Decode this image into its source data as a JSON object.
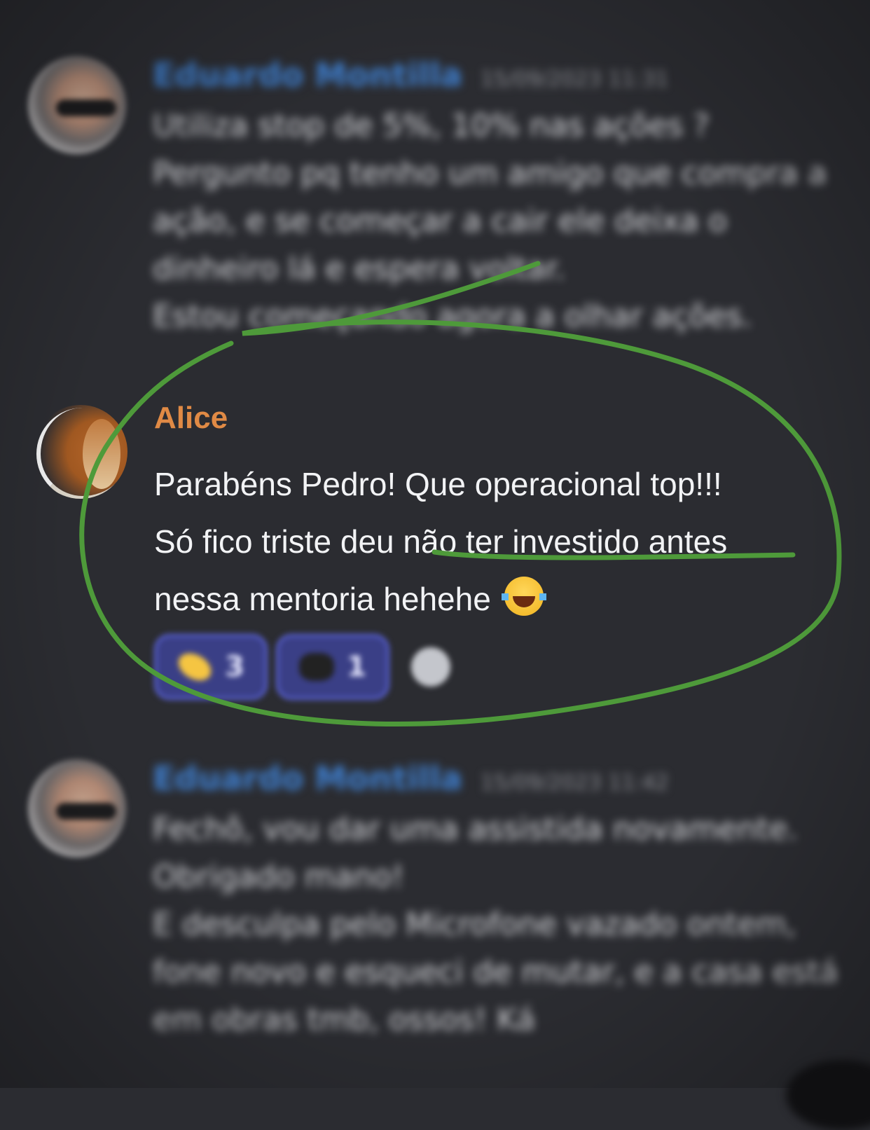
{
  "messages": [
    {
      "id": "msg-1",
      "author": "Eduardo Montilla",
      "timestamp": "15/09/2023 11:31",
      "blurred": true,
      "lines": [
        "Utiliza stop de 5%, 10% nas ações ?",
        "Pergunto pq tenho um amigo que compra a",
        "ação, e se começar a cair ele deixa o",
        "dinheiro lá e espera voltar.",
        "Estou começando agora a olhar ações."
      ]
    },
    {
      "id": "msg-2",
      "author": "Alice",
      "author_color": "#e08a45",
      "blurred": false,
      "lines": [
        "Parabéns Pedro! Que operacional top!!!",
        "Só fico triste deu não ter investido antes",
        "nessa mentoria hehehe"
      ],
      "emoji": "joy-emoji",
      "reactions": [
        {
          "emoji": "moon-reaction-icon",
          "count": "3"
        },
        {
          "emoji": "dark-reaction-icon",
          "count": "1"
        }
      ]
    },
    {
      "id": "msg-3",
      "author": "Eduardo Montilla",
      "timestamp": "15/09/2023 11:42",
      "blurred": true,
      "lines": [
        "Fechô, vou dar uma assistida novamente.",
        "Obrigado mano!",
        "E desculpa pelo Microfone vazado ontem,",
        "fone novo e esqueci de mutar, e a casa está",
        "em obras tmb, ossos! Ká"
      ]
    }
  ],
  "colors": {
    "background": "#2b2c31",
    "annotation_green": "#4e9a3a",
    "link_blue": "#3f7fcf"
  }
}
